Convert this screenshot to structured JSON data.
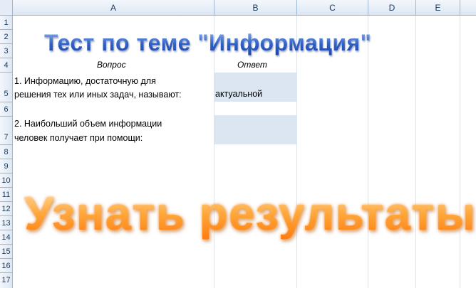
{
  "sheet": {
    "columns": [
      "A",
      "B",
      "C",
      "D",
      "E"
    ],
    "rows": [
      "1",
      "2",
      "3",
      "4",
      "5",
      "6",
      "7",
      "8",
      "9",
      "10",
      "11",
      "12",
      "13",
      "14",
      "15",
      "16",
      "17"
    ]
  },
  "title": "Тест по теме \"Информация\"",
  "headers": {
    "question": "Вопрос",
    "answer": "Ответ"
  },
  "questions": [
    {
      "line1": "1.  Информацию, достаточную для",
      "line2": "решения тех или иных задач, называют:",
      "answer": "актуальной"
    },
    {
      "line1": "2. Наибольший объем информации",
      "line2": "человек получает при помощи:",
      "answer": ""
    }
  ],
  "result_button": "Узнать результаты",
  "colors": {
    "title": "#2f5fc4",
    "result": "#ff8c1a",
    "answer_fill": "#dce6f2"
  }
}
